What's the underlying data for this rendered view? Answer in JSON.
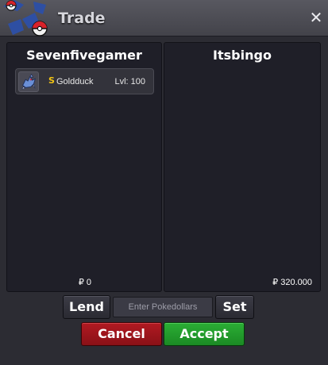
{
  "window": {
    "title": "Trade",
    "close_glyph": "✕"
  },
  "left_panel": {
    "player_name": "Sevenfivegamer",
    "money_display": "₽ 0",
    "items": [
      {
        "badge": "S",
        "badge_color": "#f2c413",
        "name": "Goldduck",
        "level": "Lvl: 100",
        "icon": "golduck-sprite-icon"
      }
    ]
  },
  "right_panel": {
    "player_name": "Itsbingo",
    "money_display": "₽ 320.000"
  },
  "controls": {
    "lend_label": "Lend",
    "amount_placeholder": "Enter Pokedollars",
    "set_label": "Set",
    "cancel_label": "Cancel",
    "accept_label": "Accept"
  },
  "colors": {
    "cancel": "#b11a22",
    "accept": "#2bae35",
    "panel": "#1f1f28",
    "titlebar": "#4d4d55"
  }
}
